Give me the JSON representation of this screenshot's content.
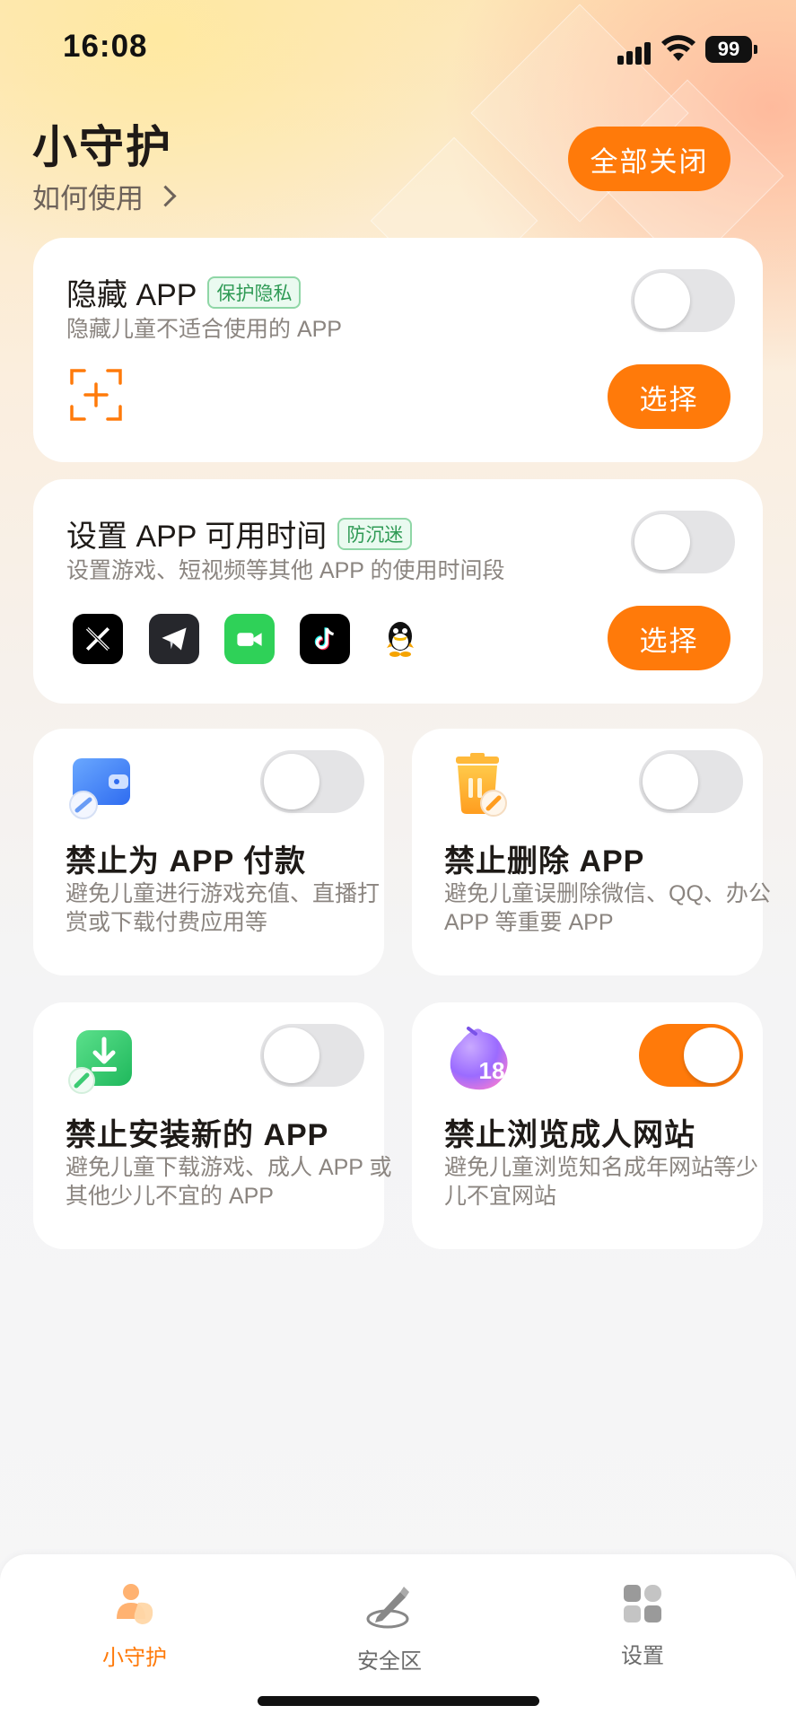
{
  "status_bar": {
    "time": "16:08",
    "battery": "99"
  },
  "header": {
    "title": "小守护",
    "howto": "如何使用",
    "close_all": "全部关闭"
  },
  "hide_app": {
    "title": "隐藏 APP",
    "tag": "保护隐私",
    "subtitle": "隐藏儿童不适合使用的 APP",
    "toggle_on": false,
    "select_label": "选择",
    "add_icon": "add-scan-icon"
  },
  "app_time": {
    "title": "设置 APP 可用时间",
    "tag": "防沉迷",
    "subtitle": "设置游戏、短视频等其他 APP 的使用时间段",
    "toggle_on": false,
    "select_label": "选择",
    "apps": [
      "x-app-icon",
      "telegram-app-icon",
      "facetime-app-icon",
      "tiktok-app-icon",
      "qq-app-icon"
    ]
  },
  "features": [
    {
      "title": "禁止为 APP 付款",
      "desc": "避免儿童进行游戏充值、直播打赏或下载付费应用等",
      "toggle_on": false,
      "icon": "wallet-block-icon"
    },
    {
      "title": "禁止删除 APP",
      "desc": "避免儿童误删除微信、QQ、办公 APP 等重要 APP",
      "toggle_on": false,
      "icon": "trash-block-icon"
    },
    {
      "title": "禁止安装新的 APP",
      "desc": "避免儿童下载游戏、成人 APP 或其他少儿不宜的 APP",
      "toggle_on": false,
      "icon": "download-block-icon"
    },
    {
      "title": "禁止浏览成人网站",
      "desc": "避免儿童浏览知名成年网站等少儿不宜网站",
      "toggle_on": true,
      "icon": "adult-18-icon"
    }
  ],
  "tabbar": {
    "tabs": [
      {
        "label": "小守护",
        "active": true,
        "icon": "guardian-icon"
      },
      {
        "label": "安全区",
        "active": false,
        "icon": "pen-zone-icon"
      },
      {
        "label": "设置",
        "active": false,
        "icon": "settings-grid-icon"
      }
    ]
  },
  "colors": {
    "accent": "#ff7a0a",
    "tag_green": "#2f9a55",
    "toggle_off": "#e4e4e6"
  }
}
